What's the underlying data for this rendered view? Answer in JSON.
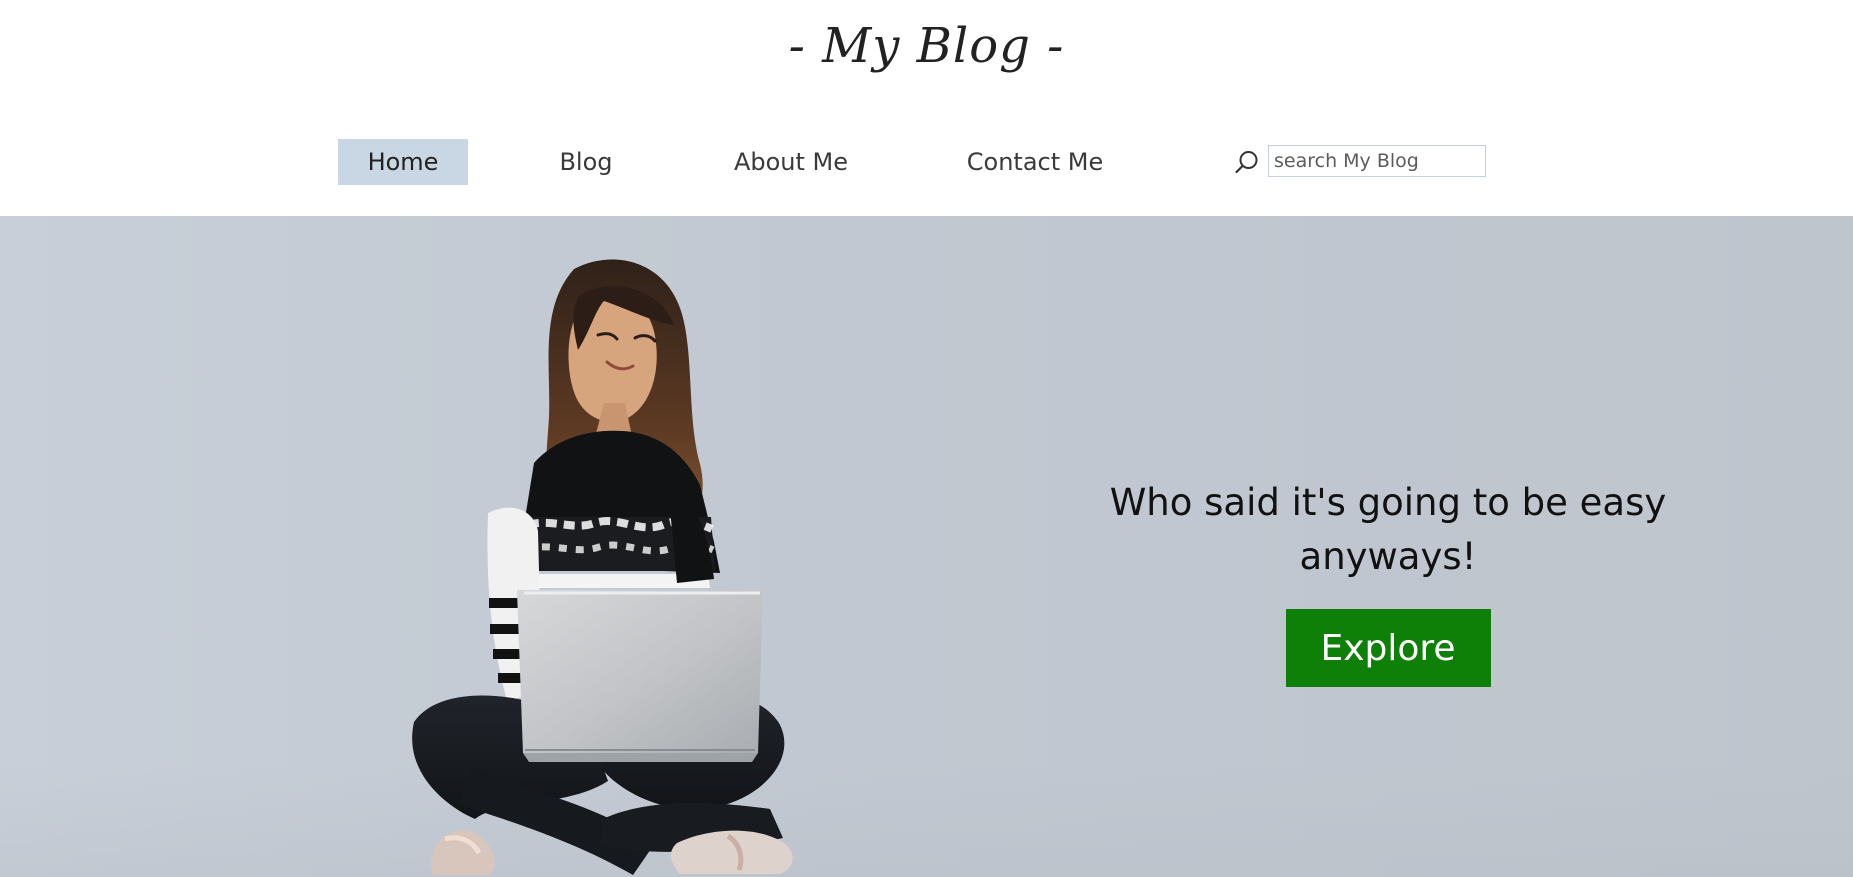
{
  "header": {
    "logo_text": "- My Blog -"
  },
  "nav": {
    "items": [
      {
        "label": "Home",
        "active": true
      },
      {
        "label": "Blog",
        "active": false
      },
      {
        "label": "About Me",
        "active": false
      },
      {
        "label": "Contact Me",
        "active": false
      }
    ],
    "search": {
      "placeholder": "search My Blog",
      "icon": "search-icon"
    }
  },
  "hero": {
    "tagline_line1": "Who said it's going to be easy",
    "tagline_line2": "anyways!",
    "button_label": "Explore",
    "button_color": "#0f8007",
    "image_subject": "woman-with-laptop-illustration"
  },
  "colors": {
    "active_nav_bg": "#c9d6e3",
    "hero_bg": "#c1c8d1"
  }
}
